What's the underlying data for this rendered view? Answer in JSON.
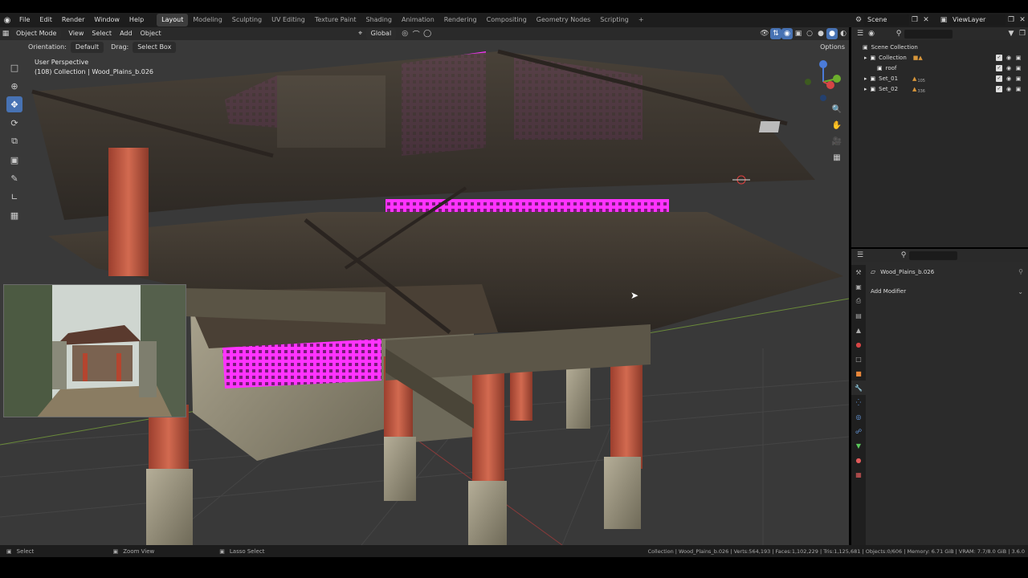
{
  "menu": {
    "items": [
      "File",
      "Edit",
      "Render",
      "Window",
      "Help"
    ],
    "workspaces": [
      "Layout",
      "Modeling",
      "Sculpting",
      "UV Editing",
      "Texture Paint",
      "Shading",
      "Animation",
      "Rendering",
      "Compositing",
      "Geometry Nodes",
      "Scripting"
    ],
    "add_workspace": "+",
    "scene_name": "Scene",
    "viewlayer_name": "ViewLayer"
  },
  "viewport_header": {
    "mode": "Object Mode",
    "menus": [
      "View",
      "Select",
      "Add",
      "Object"
    ],
    "transform_orientation": "Global",
    "orientation_label": "Orientation:",
    "orientation_value": "Default",
    "drag_label": "Drag:",
    "drag_value": "Select Box",
    "options_label": "Options"
  },
  "viewport": {
    "perspective": "User Perspective",
    "object_info": "(108) Collection | Wood_Plains_b.026",
    "colors": {
      "background": "#393939",
      "grid": "#454545",
      "highlight": "#ff22ff",
      "roof": "#3a342c",
      "pillar": "#c8553f",
      "stone": "#a6a08a"
    }
  },
  "toolbar": {
    "tools": [
      "select-box",
      "cursor",
      "move",
      "rotate",
      "scale",
      "transform",
      "annotate",
      "measure",
      "add-cube"
    ],
    "active_tool": "move"
  },
  "outliner": {
    "title": "Scene Collection",
    "items": [
      {
        "name": "Collection",
        "level": 1
      },
      {
        "name": "roof",
        "level": 2
      },
      {
        "name": "Set_01",
        "level": 1,
        "badge": "105"
      },
      {
        "name": "Set_02",
        "level": 1,
        "badge": "336"
      }
    ]
  },
  "properties": {
    "object_name": "Wood_Plains_b.026",
    "add_modifier": "Add Modifier"
  },
  "statusbar": {
    "left": [
      {
        "icon": "mouse-left-icon",
        "label": "Select"
      },
      {
        "icon": "mouse-middle-icon",
        "label": "Zoom View"
      },
      {
        "icon": "mouse-right-icon",
        "label": "Lasso Select"
      }
    ],
    "stats": "Collection | Wood_Plains_b.026 | Verts:564,193 | Faces:1,102,229 | Tris:1,125,681 | Objects:0/606 | Memory: 6.71 GiB | VRAM: 7.7/8.0 GiB | 3.6.0"
  }
}
